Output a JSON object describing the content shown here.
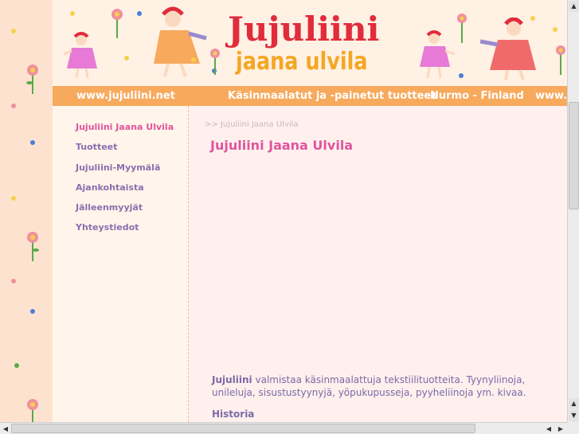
{
  "banner": {
    "title": "Jujuliini",
    "subtitle": "jaana ulvila"
  },
  "navbar": {
    "url": "www.jujuliini.net",
    "tagline": "Käsinmaalatut  ja -painetut tuotteet",
    "location": "Nurmo - Finland",
    "url_repeat": "www.jujuliini.net"
  },
  "sidebar": {
    "items": [
      {
        "label": "Jujuliini Jaana Ulvila",
        "active": true
      },
      {
        "label": "Tuotteet"
      },
      {
        "label": "Jujuliini-Myymälä"
      },
      {
        "label": "Ajankohtaista"
      },
      {
        "label": "Jälleenmyyjät"
      },
      {
        "label": "Yhteystiedot"
      }
    ]
  },
  "main": {
    "breadcrumb": ">> Jujuliini Jaana Ulvila",
    "title": "Jujuliini Jaana Ulvila",
    "intro_bold": "Jujuliini",
    "intro_text": " valmistaa käsinmaalattuja tekstiilituotteita. Tyynyliinoja, unileluja, sisustustyynyjä, yöpukupusseja, pyyheliinoja ym. kivaa.",
    "history_heading": "Historia"
  },
  "colors": {
    "page_bg": "#fde3cf",
    "nav_bar": "#f7a95c",
    "title_red": "#e02c3b",
    "subtitle_orange": "#f5a623",
    "link_purple": "#8a6fb0",
    "active_pink": "#e0559d"
  },
  "icons": {
    "scroll_up": "▲",
    "scroll_down": "▼",
    "scroll_left": "◀",
    "scroll_right": "▶"
  }
}
